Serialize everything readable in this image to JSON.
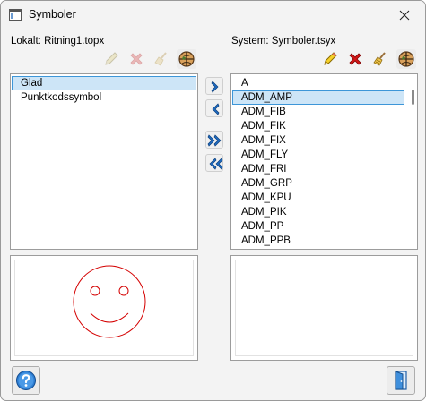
{
  "window": {
    "title": "Symboler"
  },
  "local": {
    "label": "Lokalt: Ritning1.topx",
    "items": [
      "Glad",
      "Punktkodssymbol"
    ],
    "selected_index": 0
  },
  "system": {
    "label": "System: Symboler.tsyx",
    "items": [
      "A",
      "ADM_AMP",
      "ADM_FIB",
      "ADM_FIK",
      "ADM_FIX",
      "ADM_FLY",
      "ADM_FRI",
      "ADM_GRP",
      "ADM_KPU",
      "ADM_PIK",
      "ADM_PP",
      "ADM_PPB"
    ],
    "selected_index": 1
  },
  "toolbar_icons": [
    "pencil-icon",
    "delete-x-icon",
    "broom-icon",
    "globe-icon"
  ],
  "transfer_icons": [
    "arrow-right-icon",
    "arrow-left-icon",
    "double-arrow-right-icon",
    "double-arrow-left-icon"
  ],
  "preview": {
    "symbol_icon": "smiley-face-icon",
    "symbol_color": "#d40000"
  },
  "colors": {
    "selection_fill": "#cde5f7",
    "selection_border": "#3d96d8",
    "arrow_blue": "#1e6bc2",
    "delete_red": "#d41818"
  },
  "footer_icons": [
    "help-icon",
    "exit-door-icon"
  ]
}
